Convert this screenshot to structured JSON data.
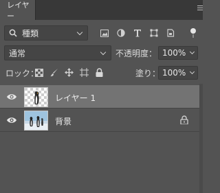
{
  "panel": {
    "tab_label": "レイヤー"
  },
  "filter": {
    "kind_label": "種類",
    "icons": [
      "image-filter-icon",
      "adjustment-filter-icon",
      "type-filter-icon",
      "shape-filter-icon",
      "smart-object-filter-icon",
      "filter-toggle-icon"
    ]
  },
  "blend": {
    "mode": "通常",
    "opacity_label": "不透明度：",
    "opacity_value": "100%"
  },
  "lock": {
    "label": "ロック：",
    "fill_label": "塗り：",
    "fill_value": "100%",
    "icons": [
      "lock-transparent-icon",
      "lock-image-icon",
      "lock-position-icon",
      "lock-artboard-icon",
      "lock-all-icon"
    ]
  },
  "layers": [
    {
      "name": "レイヤー 1",
      "selected": true,
      "visible": true
    },
    {
      "name": "背景",
      "selected": false,
      "visible": true,
      "locked": true
    }
  ],
  "colors": {
    "panel_bg": "#535353",
    "selected_row": "#737373",
    "tab_bar": "#383838"
  }
}
